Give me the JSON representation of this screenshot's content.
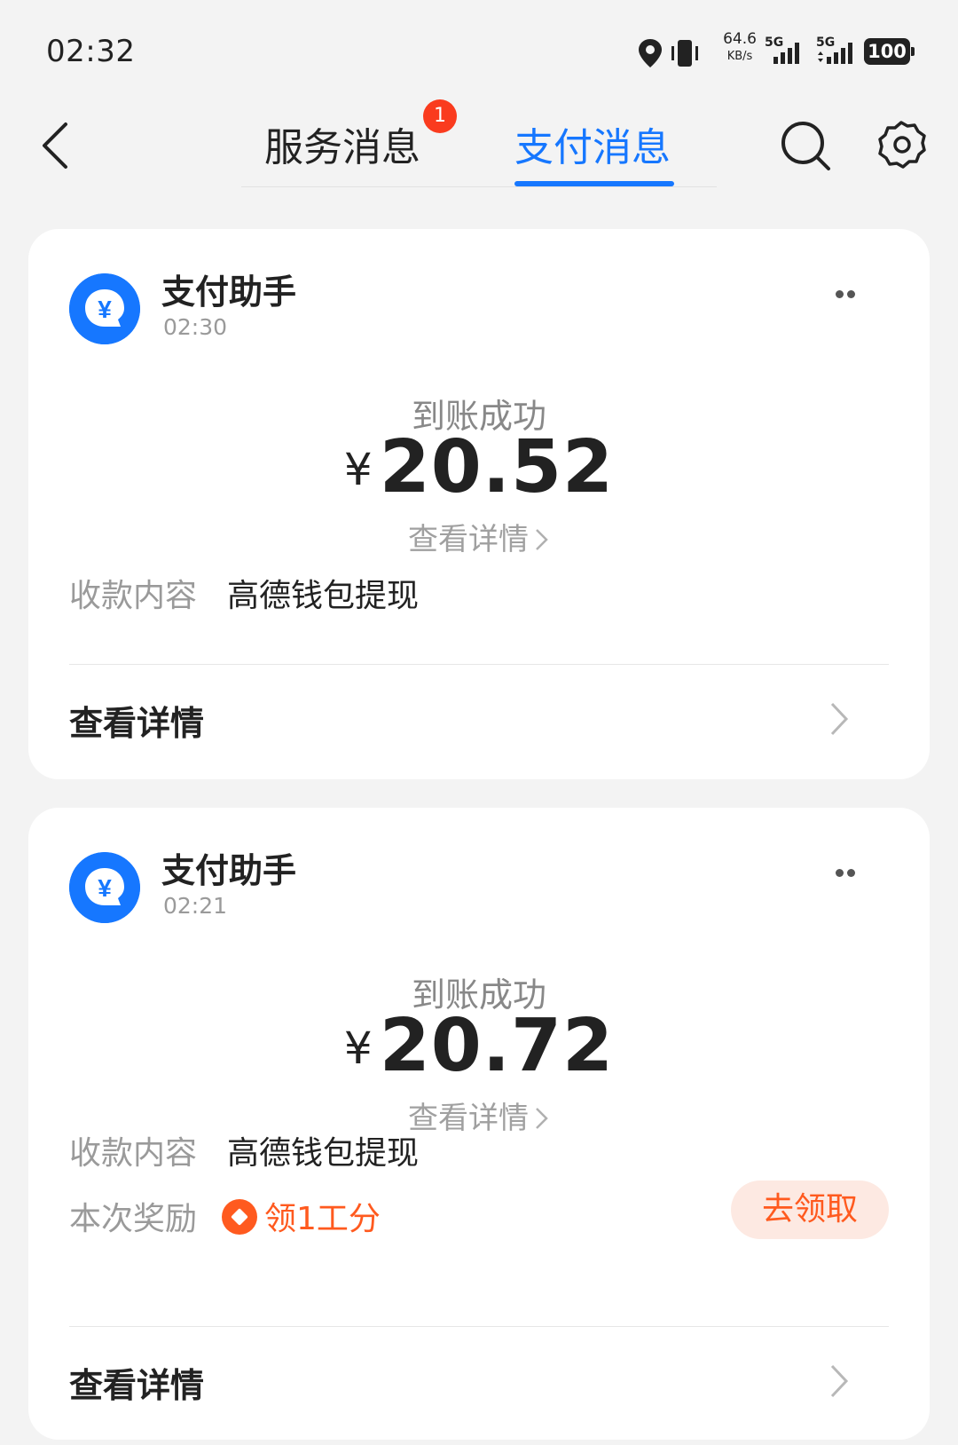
{
  "status_bar": {
    "time": "02:32",
    "net_speed_value": "64.6",
    "net_speed_unit": "KB/s",
    "sim1_label": "5G",
    "sim2_label": "5G",
    "battery": "100",
    "icons": [
      "location-icon",
      "vibrate-icon",
      "signal-icon",
      "signal-icon",
      "battery-icon"
    ]
  },
  "header": {
    "tabs": [
      {
        "label": "服务消息",
        "badge": "1",
        "active": false
      },
      {
        "label": "支付消息",
        "active": true
      }
    ],
    "icons": [
      "back-icon",
      "search-icon",
      "settings-icon"
    ],
    "accent_color": "#1677ff"
  },
  "messages": [
    {
      "sender": "支付助手",
      "time": "02:30",
      "status": "到账成功",
      "currency": "¥",
      "amount": "20.52",
      "detail_link": "查看详情",
      "fields": [
        {
          "label": "收款内容",
          "value": "高德钱包提现"
        }
      ],
      "footer": "查看详情"
    },
    {
      "sender": "支付助手",
      "time": "02:21",
      "status": "到账成功",
      "currency": "¥",
      "amount": "20.72",
      "detail_link": "查看详情",
      "fields": [
        {
          "label": "收款内容",
          "value": "高德钱包提现"
        },
        {
          "label": "本次奖励",
          "value": "领1工分"
        }
      ],
      "claim_button": "去领取",
      "footer": "查看详情"
    }
  ],
  "colors": {
    "reward": "#ff5a1f",
    "badge": "#fa3b1e",
    "background": "#f3f3f3"
  }
}
